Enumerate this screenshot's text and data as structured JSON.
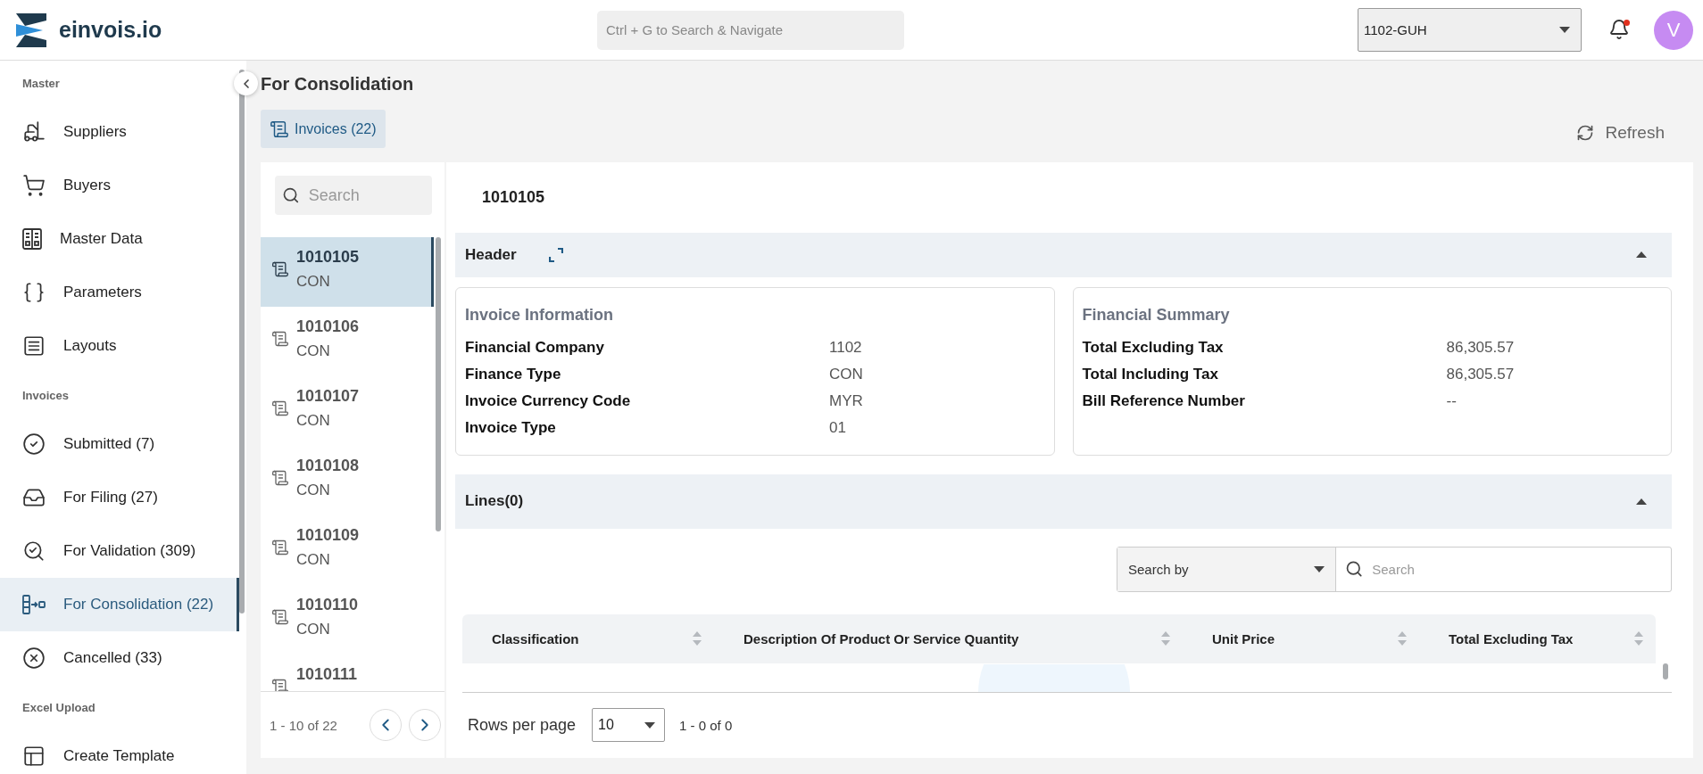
{
  "header": {
    "logo_text": "einvois.io",
    "search": {
      "placeholder": "Ctrl + G to Search & Navigate"
    },
    "company_select": {
      "value": "1102-GUH"
    },
    "notifications": {
      "unread": true
    },
    "avatar": {
      "initial": "V"
    }
  },
  "sidebar": {
    "sections": [
      {
        "title": "Master",
        "items": [
          {
            "label": "Suppliers",
            "selected": false
          },
          {
            "label": "Buyers",
            "selected": false
          },
          {
            "label": "Master Data",
            "selected": false
          },
          {
            "label": "Parameters",
            "selected": false
          },
          {
            "label": "Layouts",
            "selected": false
          }
        ]
      },
      {
        "title": "Invoices",
        "items": [
          {
            "label": "Submitted (7)",
            "selected": false
          },
          {
            "label": "For Filing (27)",
            "selected": false
          },
          {
            "label": "For Validation (309)",
            "selected": false
          },
          {
            "label": "For Consolidation (22)",
            "selected": true
          },
          {
            "label": "Cancelled (33)",
            "selected": false
          }
        ]
      },
      {
        "title": "Excel Upload",
        "items": [
          {
            "label": "Create Template",
            "selected": false
          }
        ]
      }
    ]
  },
  "page": {
    "title": "For Consolidation",
    "tabs": [
      {
        "label": "Invoices (22)",
        "selected": true
      }
    ],
    "refresh": "Refresh"
  },
  "invoice_list": {
    "search": {
      "placeholder": "Search"
    },
    "items": [
      {
        "number": "1010105",
        "type": "CON",
        "selected": true
      },
      {
        "number": "1010106",
        "type": "CON",
        "selected": false
      },
      {
        "number": "1010107",
        "type": "CON",
        "selected": false
      },
      {
        "number": "1010108",
        "type": "CON",
        "selected": false
      },
      {
        "number": "1010109",
        "type": "CON",
        "selected": false
      },
      {
        "number": "1010110",
        "type": "CON",
        "selected": false
      },
      {
        "number": "1010111",
        "selected": false
      }
    ],
    "pagination": "1 - 10 of 22"
  },
  "detail": {
    "title": "1010105",
    "header_section": {
      "title": "Header",
      "expanded": true,
      "cards": [
        {
          "title": "Invoice Information",
          "fields": [
            {
              "label": "Financial Company",
              "value": "1102"
            },
            {
              "label": "Finance Type",
              "value": "CON"
            },
            {
              "label": "Invoice Currency Code",
              "value": "MYR"
            },
            {
              "label": "Invoice Type",
              "value": "01"
            }
          ]
        },
        {
          "title": "Financial Summary",
          "fields": [
            {
              "label": "Total Excluding Tax",
              "value": "86,305.57"
            },
            {
              "label": "Total Including Tax",
              "value": "86,305.57"
            },
            {
              "label": "Bill Reference Number",
              "value": "--"
            }
          ]
        }
      ]
    },
    "lines_section": {
      "title": "Lines(0)",
      "expanded": true,
      "search_by": {
        "value": "Search by"
      },
      "search": {
        "placeholder": "Search"
      },
      "columns": [
        "Classification",
        "Description Of Product Or Service Quantity",
        "Unit Price",
        "Total Excluding Tax"
      ],
      "rows_per_page_label": "Rows per page",
      "rows_per_page": "10",
      "range": "1 - 0 of 0"
    }
  }
}
